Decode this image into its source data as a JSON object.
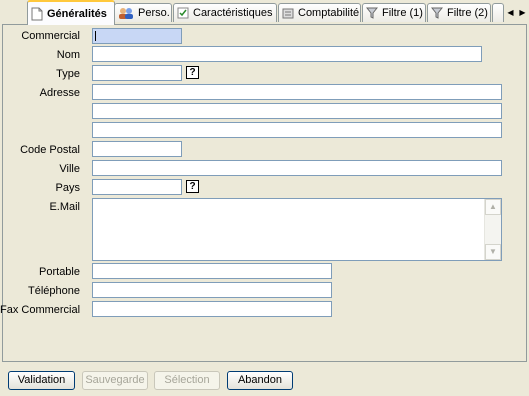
{
  "tabs": [
    {
      "label": "Généralités",
      "icon": "document-icon"
    },
    {
      "label": "Perso.",
      "icon": "people-icon"
    },
    {
      "label": "Caractéristiques",
      "icon": "settings-icon"
    },
    {
      "label": "Comptabilité",
      "icon": "ledger-icon"
    },
    {
      "label": "Filtre (1)",
      "icon": "funnel-icon"
    },
    {
      "label": "Filtre (2)",
      "icon": "funnel-icon"
    }
  ],
  "form": {
    "commercial": {
      "label": "Commercial",
      "value": ""
    },
    "nom": {
      "label": "Nom",
      "value": ""
    },
    "type": {
      "label": "Type",
      "value": "",
      "help": "?"
    },
    "adresse": {
      "label": "Adresse",
      "line1": "",
      "line2": "",
      "line3": ""
    },
    "code_postal": {
      "label": "Code Postal",
      "value": ""
    },
    "ville": {
      "label": "Ville",
      "value": ""
    },
    "pays": {
      "label": "Pays",
      "value": "",
      "help": "?"
    },
    "email": {
      "label": "E.Mail",
      "value": ""
    },
    "portable": {
      "label": "Portable",
      "value": ""
    },
    "telephone": {
      "label": "Téléphone",
      "value": ""
    },
    "fax": {
      "label": "Fax Commercial",
      "value": ""
    }
  },
  "buttons": {
    "validation": "Validation",
    "sauvegarde": "Sauvegarde",
    "selection": "Sélection",
    "abandon": "Abandon"
  },
  "colors": {
    "window_bg": "#ece9d8",
    "field_border": "#7f9db9",
    "focus_bg": "#c8d7f5",
    "tab_highlight": "#ffc83c"
  }
}
